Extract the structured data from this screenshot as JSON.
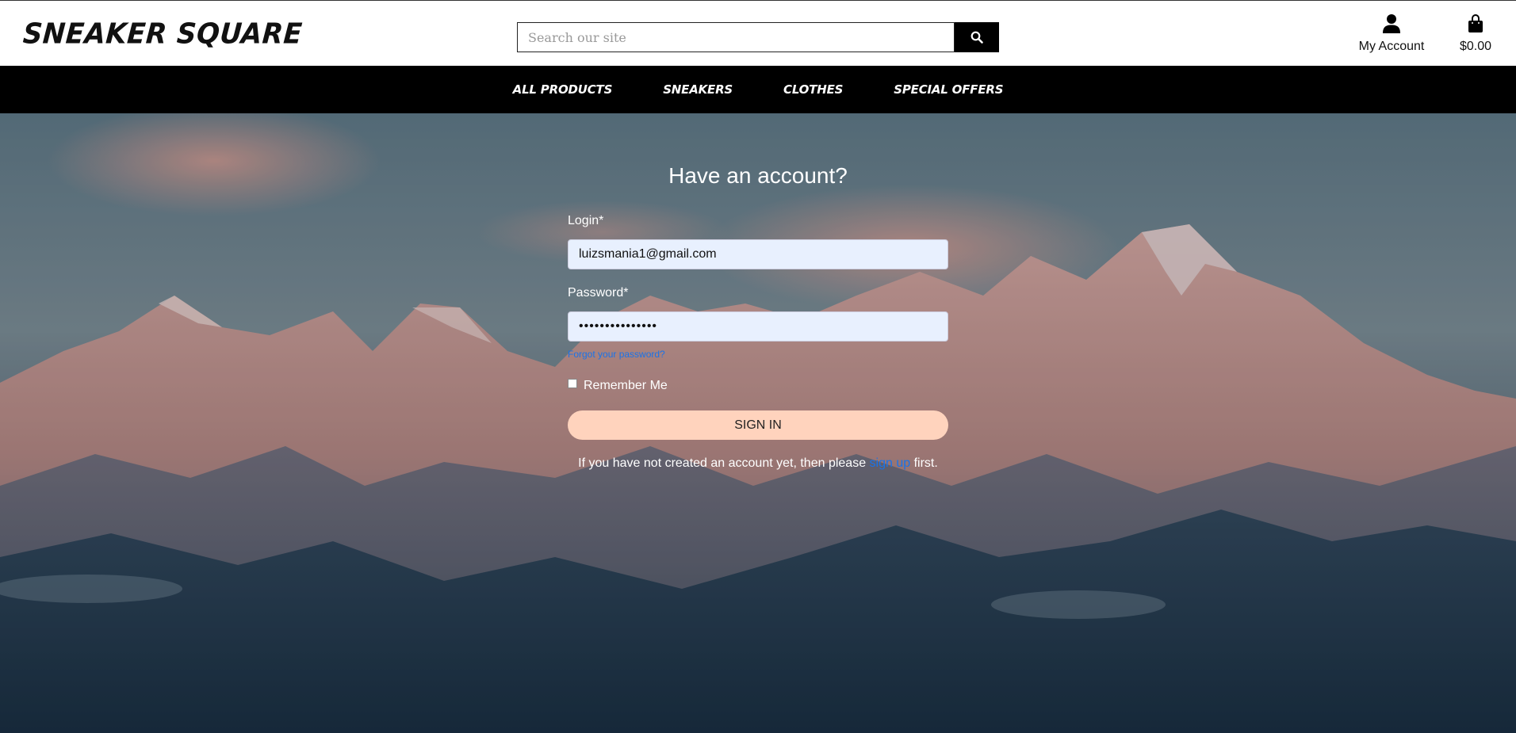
{
  "header": {
    "logo": "SNEAKER SQUARE",
    "search_placeholder": "Search our site",
    "search_icon": "search-icon",
    "account_label": "My Account",
    "account_icon": "user-icon",
    "cart_total": "$0.00",
    "cart_icon": "shopping-bag-icon"
  },
  "nav": {
    "items": [
      "ALL PRODUCTS",
      "SNEAKERS",
      "CLOTHES",
      "SPECIAL OFFERS"
    ]
  },
  "login": {
    "title": "Have an account?",
    "login_label": "Login*",
    "login_value": "luizsmania1@gmail.com",
    "password_label": "Password*",
    "password_value": "•••••••••••••••",
    "forgot_link": "Forgot your password?",
    "remember_label": "Remember Me",
    "remember_checked": false,
    "signin_button": "SIGN IN",
    "signup_prefix": "If you have not created an account yet, then please",
    "signup_link": "sign up",
    "signup_suffix": "first."
  },
  "colors": {
    "nav_bg": "#000000",
    "signin_bg": "#ffd3bd",
    "link": "#1a73e8",
    "input_bg": "#e8f0fe"
  }
}
